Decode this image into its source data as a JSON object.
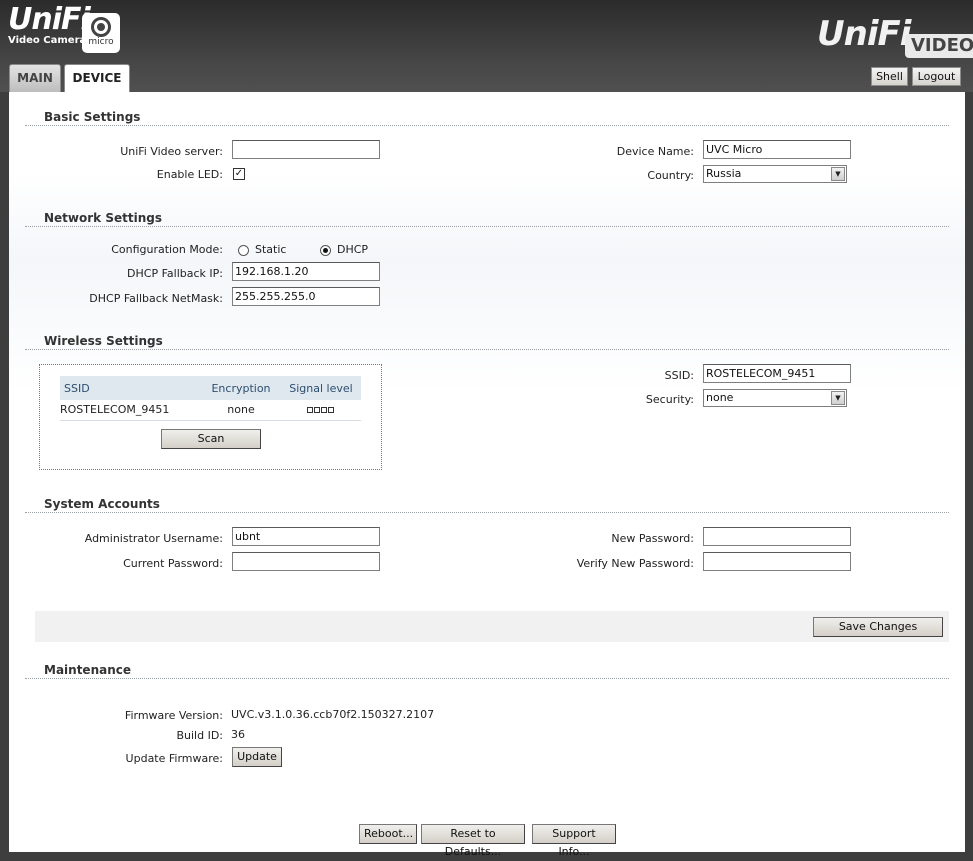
{
  "header": {
    "left_brand": "UniFi",
    "left_sub": "Video Camera",
    "badge": "micro",
    "right_brand": "UniFi",
    "right_badge": "VIDEO",
    "tabs": [
      {
        "label": "MAIN",
        "active": false
      },
      {
        "label": "DEVICE",
        "active": true
      }
    ],
    "shell_label": "Shell",
    "logout_label": "Logout"
  },
  "basic": {
    "title": "Basic Settings",
    "server_label": "UniFi Video server:",
    "server_value": "",
    "led_label": "Enable LED:",
    "led_checked": true,
    "device_name_label": "Device Name:",
    "device_name_value": "UVC Micro",
    "country_label": "Country:",
    "country_value": "Russia"
  },
  "network": {
    "title": "Network Settings",
    "mode_label": "Configuration Mode:",
    "static_label": "Static",
    "dhcp_label": "DHCP",
    "selected_mode": "DHCP",
    "fallback_ip_label": "DHCP Fallback IP:",
    "fallback_ip_value": "192.168.1.20",
    "fallback_mask_label": "DHCP Fallback NetMask:",
    "fallback_mask_value": "255.255.255.0"
  },
  "wireless": {
    "title": "Wireless Settings",
    "columns": [
      "SSID",
      "Encryption",
      "Signal level"
    ],
    "networks": [
      {
        "ssid": "ROSTELECOM_9451",
        "encryption": "none",
        "signal_bars": 4
      }
    ],
    "scan_label": "Scan",
    "ssid_label": "SSID:",
    "ssid_value": "ROSTELECOM_9451",
    "security_label": "Security:",
    "security_value": "none"
  },
  "accounts": {
    "title": "System Accounts",
    "admin_user_label": "Administrator Username:",
    "admin_user_value": "ubnt",
    "current_pw_label": "Current Password:",
    "current_pw_value": "",
    "new_pw_label": "New Password:",
    "new_pw_value": "",
    "verify_pw_label": "Verify New Password:",
    "verify_pw_value": "",
    "save_label": "Save Changes"
  },
  "maintenance": {
    "title": "Maintenance",
    "firmware_label": "Firmware Version:",
    "firmware_value": "UVC.v3.1.0.36.ccb70f2.150327.2107",
    "build_label": "Build ID:",
    "build_value": "36",
    "update_label": "Update Firmware:",
    "update_button": "Update",
    "reboot_button": "Reboot...",
    "reset_button": "Reset to Defaults...",
    "support_button": "Support Info..."
  }
}
